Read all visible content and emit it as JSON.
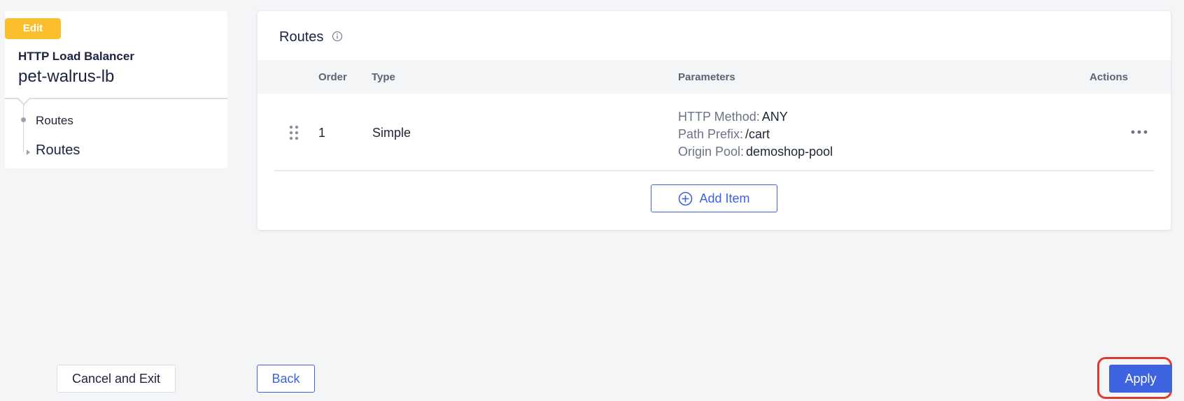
{
  "sidebar": {
    "badge": "Edit",
    "object_type": "HTTP Load Balancer",
    "object_name": "pet-walrus-lb",
    "tree": [
      {
        "label": "Routes"
      },
      {
        "label": "Routes"
      }
    ]
  },
  "routes": {
    "title": "Routes",
    "columns": {
      "order": "Order",
      "type": "Type",
      "parameters": "Parameters",
      "actions": "Actions"
    },
    "rows": [
      {
        "order": "1",
        "type": "Simple",
        "params": [
          {
            "label": "HTTP Method:",
            "value": "ANY"
          },
          {
            "label": "Path Prefix:",
            "value": "/cart"
          },
          {
            "label": "Origin Pool:",
            "value": "demoshop-pool"
          }
        ]
      }
    ],
    "add_item_label": "Add Item"
  },
  "footer": {
    "cancel_label": "Cancel and Exit",
    "back_label": "Back",
    "apply_label": "Apply"
  },
  "colors": {
    "accent": "#3d63e0",
    "badge": "#fbbf2d",
    "highlight": "#e03a2f"
  },
  "icons": {
    "title_info": "info-icon",
    "row_drag": "drag-handle-icon",
    "row_menu": "more-horizontal-icon",
    "add": "plus-circle-icon"
  }
}
